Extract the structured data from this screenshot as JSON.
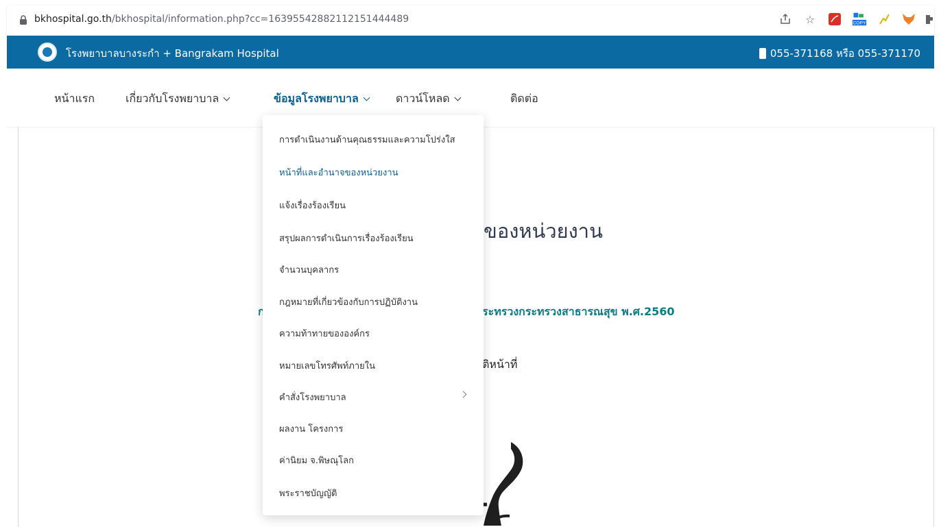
{
  "browser": {
    "url_host": "bkhospital.go.th",
    "url_path": "/bkhospital/information.php?cc=16395542882112151444489",
    "copy_badge": "COPY",
    "star_icon": "star-icon",
    "share_icon": "share-icon"
  },
  "site": {
    "title": "โรงพยาบาลบางระกำ + Bangrakam Hospital",
    "phone": "055-371168 หรือ 055-371170"
  },
  "nav": {
    "items": [
      {
        "label": "หน้าแรก"
      },
      {
        "label": "เกี่ยวกับโรงพยาบาล"
      },
      {
        "label": "ข้อมูลโรงพยาบาล"
      },
      {
        "label": "ดาวน์โหลด"
      },
      {
        "label": "ติดต่อ"
      }
    ]
  },
  "dropdown": {
    "items": [
      {
        "label": "การดำเนินงานด้านคุณธรรมและความโปร่งใส"
      },
      {
        "label": "หน้าที่และอำนาจของหน่วยงาน"
      },
      {
        "label": "แจ้งเรื่องร้องเรียน"
      },
      {
        "label": "สรุปผลการดำเนินการเรื่องร้องเรียน"
      },
      {
        "label": "จำนวนบุคลากร"
      },
      {
        "label": "กฎหมายที่เกี่ยวข้องกับการปฏิบัติงาน"
      },
      {
        "label": "ความท้าทายขององค์กร"
      },
      {
        "label": "หมายเลขโทรศัพท์ภายใน"
      },
      {
        "label": "คำสั่งโรงพยาบาล"
      },
      {
        "label": "ผลงาน โครงการ"
      },
      {
        "label": "ค่านิยม จ.พิษณุโลก"
      },
      {
        "label": "พระราชบัญญัติ"
      }
    ]
  },
  "content": {
    "heading": "ของหน่วยงาน",
    "law_prefix": "ก",
    "law_text": "ระทรวงกระทรวงสาธารณสุข พ.ศ.2560",
    "duty_text": "ติหน้าที่"
  },
  "colors": {
    "header_blue": "#0b6aa2",
    "active_blue": "#0a5f93",
    "teal": "#0b7b86"
  }
}
